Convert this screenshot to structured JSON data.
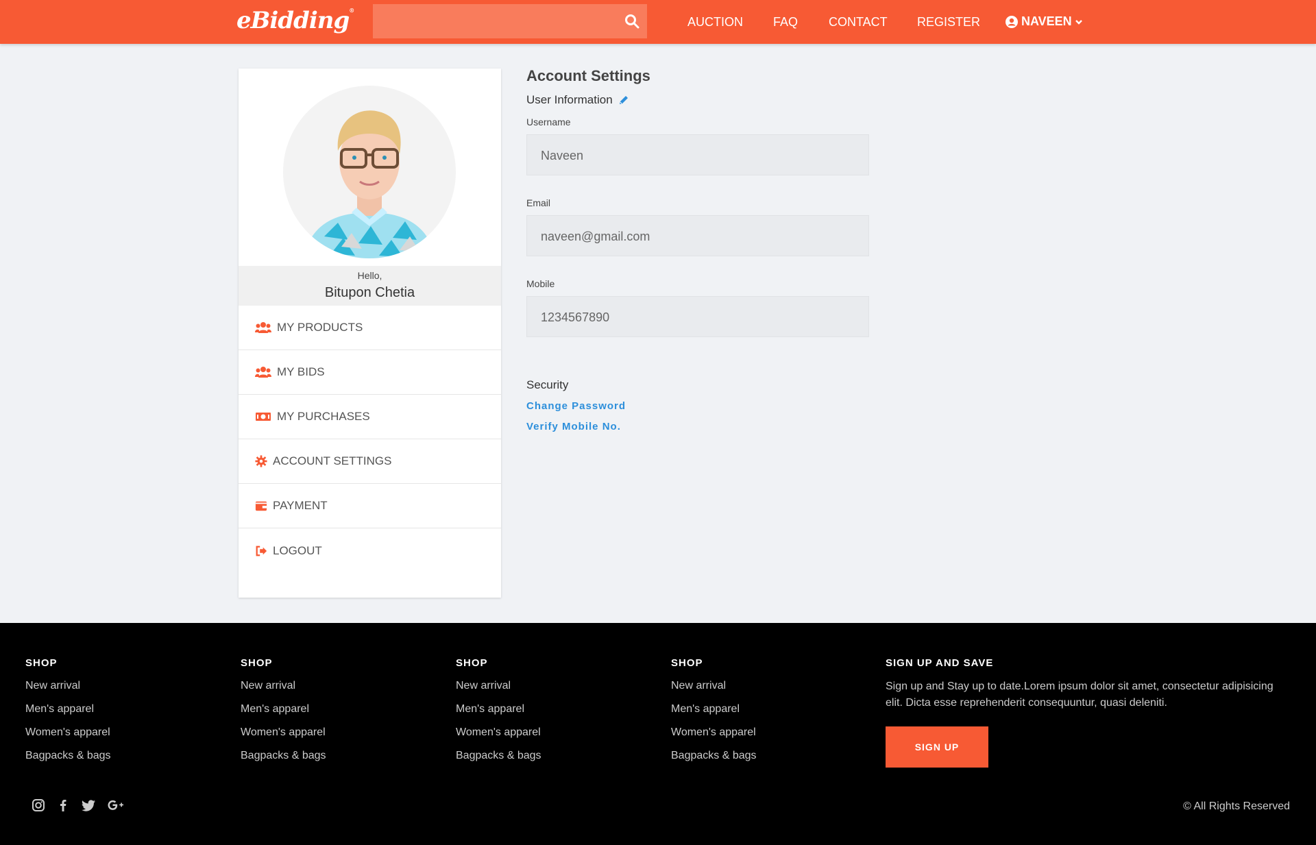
{
  "header": {
    "logo": "eBidding",
    "logo_mark": "®",
    "nav": [
      "AUCTION",
      "FAQ",
      "CONTACT",
      "REGISTER"
    ],
    "user_label": "NAVEEN",
    "colors": {
      "brand": "#f75a34",
      "search_bg": "#f97c5c"
    },
    "icons": {
      "search": "search-icon",
      "user": "user-circle-icon",
      "dropdown": "chevron-down-icon"
    }
  },
  "sidebar": {
    "greeting": "Hello,",
    "name": "Bitupon Chetia",
    "items": [
      {
        "label": "MY PRODUCTS",
        "icon": "users-icon"
      },
      {
        "label": "MY BIDS",
        "icon": "users-icon"
      },
      {
        "label": "MY PURCHASES",
        "icon": "money-bill-icon"
      },
      {
        "label": "ACCOUNT SETTINGS",
        "icon": "gear-icon"
      },
      {
        "label": "PAYMENT",
        "icon": "wallet-icon"
      },
      {
        "label": "LOGOUT",
        "icon": "sign-out-icon"
      }
    ]
  },
  "settings": {
    "title": "Account Settings",
    "subtitle": "User Information",
    "fields": [
      {
        "label": "Username",
        "value": "Naveen"
      },
      {
        "label": "Email",
        "value": "naveen@gmail.com"
      },
      {
        "label": "Mobile",
        "value": "1234567890"
      }
    ],
    "security_title": "Security",
    "links": [
      "Change Password",
      "Verify Mobile No."
    ],
    "link_color": "#2d8fdb"
  },
  "footer": {
    "columns": [
      {
        "title": "SHOP",
        "links": [
          "New arrival",
          "Men's apparel",
          "Women's apparel",
          "Bagpacks & bags"
        ]
      },
      {
        "title": "SHOP",
        "links": [
          "New arrival",
          "Men's apparel",
          "Women's apparel",
          "Bagpacks & bags"
        ]
      },
      {
        "title": "SHOP",
        "links": [
          "New arrival",
          "Men's apparel",
          "Women's apparel",
          "Bagpacks & bags"
        ]
      },
      {
        "title": "SHOP",
        "links": [
          "New arrival",
          "Men's apparel",
          "Women's apparel",
          "Bagpacks & bags"
        ]
      }
    ],
    "signup_title": "SIGN UP AND SAVE",
    "signup_text": "Sign up and Stay up to date.Lorem ipsum dolor sit amet, consectetur adipisicing elit. Dicta esse reprehenderit consequuntur, quasi deleniti.",
    "signup_button": "SIGN UP",
    "socials": [
      "instagram-icon",
      "facebook-icon",
      "twitter-icon",
      "google-plus-icon"
    ],
    "copyright": "© All Rights Reserved"
  }
}
